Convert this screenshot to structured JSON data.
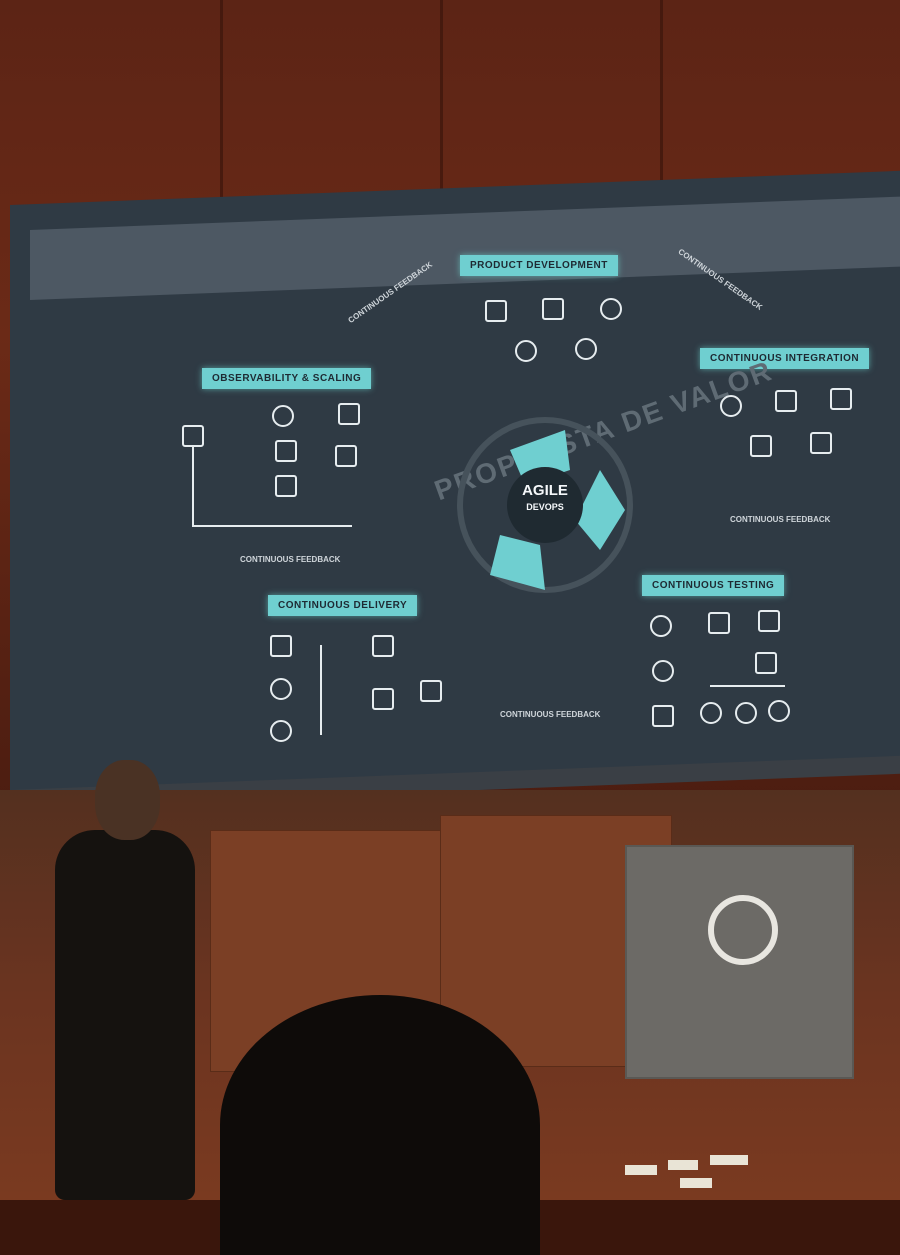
{
  "slide": {
    "ring_title": "PROPUESTA DE VALOR",
    "center": [
      "AGILE",
      "DEVOPS"
    ],
    "stages": {
      "product": "PRODUCT DEVELOPMENT",
      "ci": "CONTINUOUS INTEGRATION",
      "testing": "CONTINUOUS TESTING",
      "delivery": "CONTINUOUS DELIVERY",
      "observability": "OBSERVABILITY & SCALING"
    },
    "feedback": {
      "top_left": "CONTINUOUS FEEDBACK",
      "top_right": "CONTINUOUS FEEDBACK",
      "right": "CONTINUOUS FEEDBACK",
      "bottom": "CONTINUOUS FEEDBACK",
      "left": "CONTINUOUS FEEDBACK"
    }
  },
  "colors": {
    "accent": "#6fcfd0",
    "screen": "#2f3a44",
    "wall": "#5c2415"
  }
}
